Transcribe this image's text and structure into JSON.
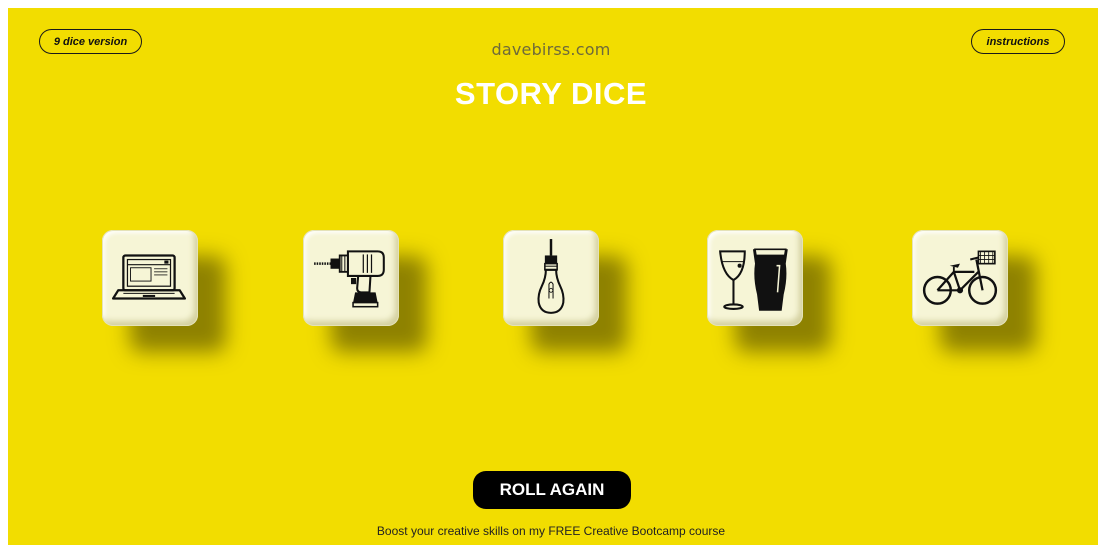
{
  "header": {
    "left_button": "9 dice version",
    "right_button": "instructions",
    "site": "davebirss.com",
    "title": "STORY DICE"
  },
  "dice": [
    {
      "icon": "laptop-icon"
    },
    {
      "icon": "power-drill-icon"
    },
    {
      "icon": "light-bulb-icon"
    },
    {
      "icon": "wine-and-beer-glasses-icon"
    },
    {
      "icon": "bicycle-icon"
    }
  ],
  "actions": {
    "roll_label": "ROLL AGAIN"
  },
  "footer": {
    "promo": "Boost your creative skills on my FREE Creative Bootcamp course"
  },
  "colors": {
    "background": "#f2dd00",
    "title": "#ffffff",
    "die_face": "#f6f5d6",
    "button": "#000000"
  }
}
